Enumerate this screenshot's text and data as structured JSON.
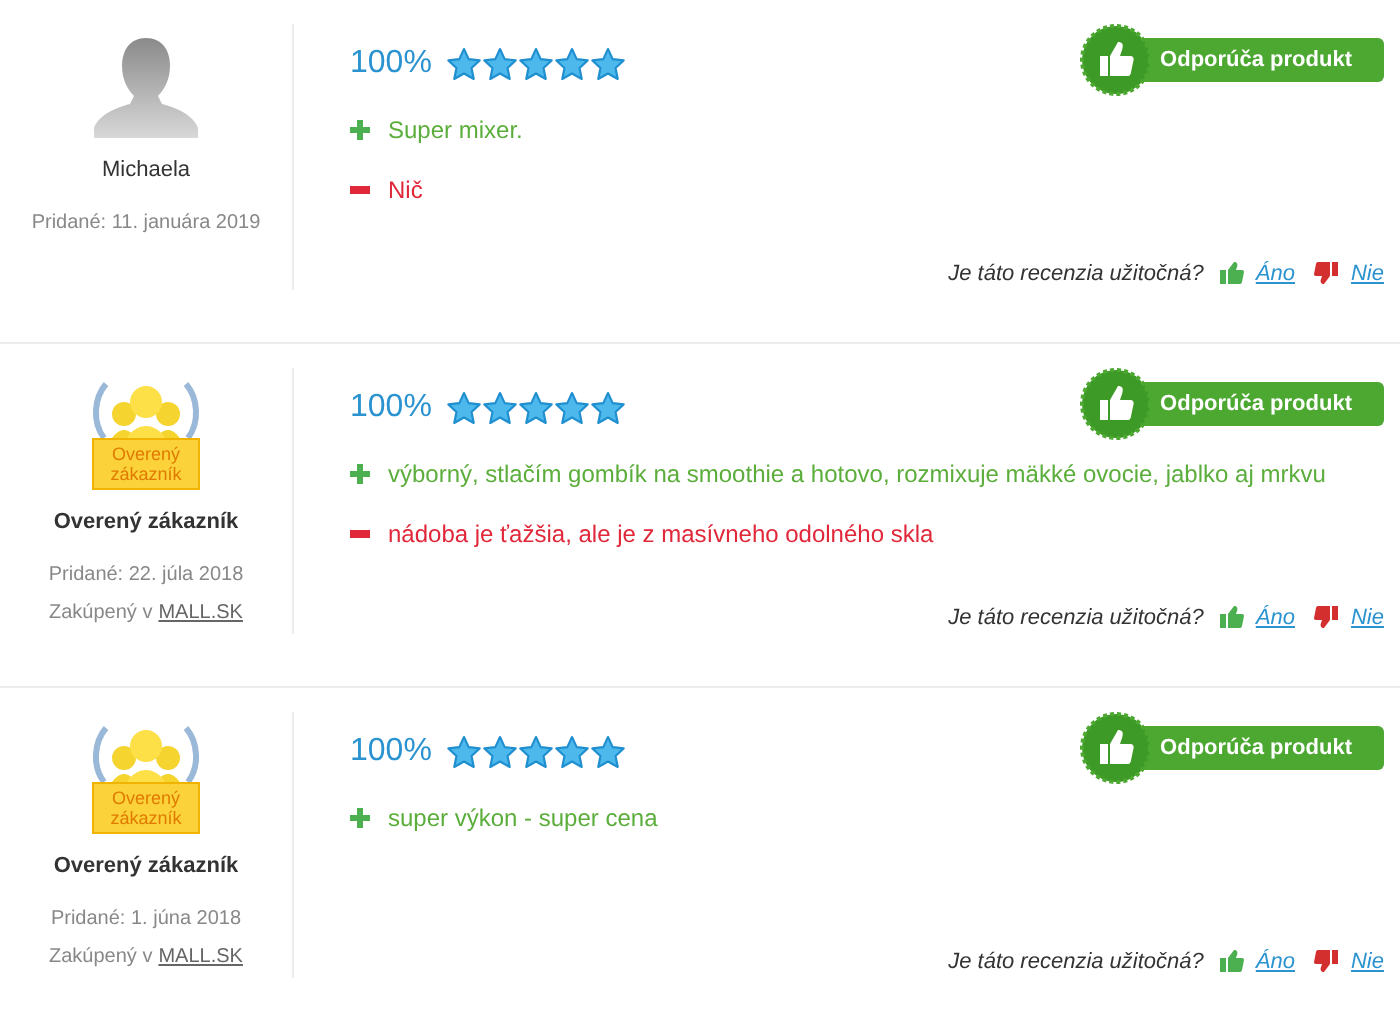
{
  "reviews": [
    {
      "avatar": {
        "kind": "silhouette"
      },
      "author": "Michaela",
      "added": "Pridané: 11. januára 2019",
      "rating": "100%",
      "stars": 5,
      "recommend": "Odporúča produkt",
      "points": [
        {
          "kind": "pro",
          "text": "Super mixer."
        },
        {
          "kind": "con",
          "text": "Nič"
        }
      ],
      "helpful": {
        "question": "Je táto recenzia užitočná?",
        "yes": "Áno",
        "no": "Nie"
      }
    },
    {
      "avatar": {
        "kind": "verified",
        "badge_text": "Overený zákazník"
      },
      "author": "Overený zákazník",
      "added": "Pridané: 22. júla 2018",
      "purchased": {
        "prefix": "Zakúpený v",
        "shop": "MALL.SK"
      },
      "rating": "100%",
      "stars": 5,
      "recommend": "Odporúča produkt",
      "points": [
        {
          "kind": "pro",
          "text": "výborný, stlačím gombík na smoothie a hotovo, rozmixuje mäkké ovocie, jablko aj mrkvu"
        },
        {
          "kind": "con",
          "text": "nádoba je ťažšia, ale je z masívneho odolného skla"
        }
      ],
      "helpful": {
        "question": "Je táto recenzia užitočná?",
        "yes": "Áno",
        "no": "Nie"
      }
    },
    {
      "avatar": {
        "kind": "verified",
        "badge_text": "Overený zákazník"
      },
      "author": "Overený zákazník",
      "added": "Pridané: 1. júna 2018",
      "purchased": {
        "prefix": "Zakúpený v",
        "shop": "MALL.SK"
      },
      "rating": "100%",
      "stars": 5,
      "recommend": "Odporúča produkt",
      "points": [
        {
          "kind": "pro",
          "text": "super výkon - super cena"
        }
      ],
      "helpful": {
        "question": "Je táto recenzia užitočná?",
        "yes": "Áno",
        "no": "Nie"
      }
    }
  ]
}
